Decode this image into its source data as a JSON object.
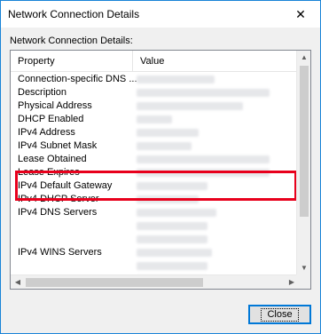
{
  "window": {
    "title": "Network Connection Details",
    "close_glyph": "✕"
  },
  "section_label": "Network Connection Details:",
  "table": {
    "columns": [
      "Property",
      "Value"
    ],
    "rows": [
      {
        "property": "Connection-specific DNS ...",
        "value": ""
      },
      {
        "property": "Description",
        "value": ""
      },
      {
        "property": "Physical Address",
        "value": ""
      },
      {
        "property": "DHCP Enabled",
        "value": ""
      },
      {
        "property": "IPv4 Address",
        "value": ""
      },
      {
        "property": "IPv4 Subnet Mask",
        "value": ""
      },
      {
        "property": "Lease Obtained",
        "value": ""
      },
      {
        "property": "Lease Expires",
        "value": ""
      },
      {
        "property": "IPv4 Default Gateway",
        "value": ""
      },
      {
        "property": "IPv4 DHCP Server",
        "value": ""
      },
      {
        "property": "IPv4 DNS Servers",
        "value": ""
      },
      {
        "property": "",
        "value": ""
      },
      {
        "property": "",
        "value": ""
      },
      {
        "property": "IPv4 WINS Servers",
        "value": ""
      },
      {
        "property": "",
        "value": ""
      },
      {
        "property": "",
        "value": ""
      }
    ]
  },
  "highlight_color": "#e8001c",
  "buttons": {
    "close_label": "Close"
  },
  "scroll_icons": {
    "up": "▲",
    "down": "▼",
    "left": "◀",
    "right": "▶"
  }
}
